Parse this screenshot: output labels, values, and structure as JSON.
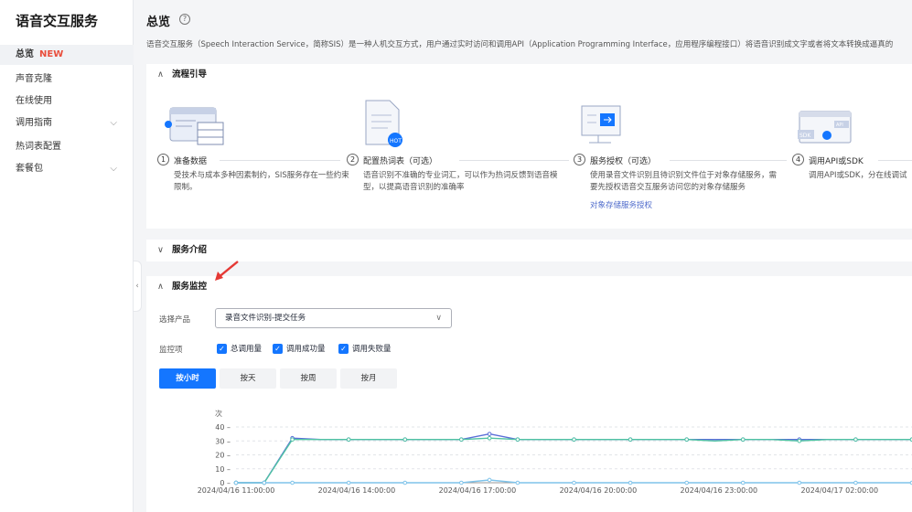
{
  "sidebar": {
    "title": "语音交互服务",
    "items": [
      {
        "label": "总览",
        "badge": "NEW"
      },
      {
        "label": "声音克隆"
      },
      {
        "label": "在线使用"
      },
      {
        "label": "调用指南",
        "chevron": "chevron-down-icon"
      },
      {
        "label": "热词表配置"
      },
      {
        "label": "套餐包",
        "chevron": "chevron-down-icon"
      }
    ]
  },
  "main": {
    "title": "总览",
    "description": "语音交互服务（Speech Interaction Service，简称SIS）是一种人机交互方式，用户通过实时访问和调用API（Application Programming Interface，应用程序编程接口）将语音识别成文字或者将文本转换成逼真的",
    "flow": {
      "header": "流程引导",
      "steps": [
        {
          "num": "1",
          "title": "准备数据",
          "desc": "受技术与成本多种因素制约，SIS服务存在一些约束限制。"
        },
        {
          "num": "2",
          "title": "配置热词表（可选）",
          "desc": "语音识别不准确的专业词汇，可以作为热词反馈到语音模型，以提高语音识别的准确率"
        },
        {
          "num": "3",
          "title": "服务授权（可选）",
          "desc": "使用录音文件识别且待识别文件位于对象存储服务，需要先授权语音交互服务访问您的对象存储服务",
          "link": "对象存储服务授权"
        },
        {
          "num": "4",
          "title": "调用API或SDK",
          "desc": "调用API或SDK，分在线调试"
        }
      ]
    },
    "intro": {
      "header": "服务介绍"
    },
    "monitor": {
      "header": "服务监控",
      "product_label": "选择产品",
      "product_value": "录音文件识别-提交任务",
      "items_label": "监控项",
      "checks": [
        "总调用量",
        "调用成功量",
        "调用失败量"
      ],
      "tabs": [
        "按小时",
        "按天",
        "按周",
        "按月"
      ],
      "active_tab": 0
    }
  },
  "chart_data": {
    "type": "line",
    "ylabel": "次",
    "ylim": [
      0,
      40
    ],
    "yticks": [
      0,
      10,
      20,
      30,
      40
    ],
    "x_tick_labels": [
      "2024/04/16 11:00:00",
      "2024/04/16 14:00:00",
      "2024/04/16 17:00:00",
      "2024/04/16 20:00:00",
      "2024/04/16 23:00:00",
      "2024/04/17 02:00:00"
    ],
    "series": [
      {
        "color": "#5b6fd8",
        "values": [
          0,
          0,
          32,
          31,
          31,
          31,
          31,
          31,
          31,
          35,
          31,
          31,
          31,
          31,
          31,
          31,
          31,
          31,
          31,
          31,
          31,
          31,
          31,
          31,
          31
        ]
      },
      {
        "color": "#4fc2a3",
        "values": [
          0,
          0,
          31,
          31,
          31,
          31,
          31,
          31,
          31,
          32,
          31,
          31,
          31,
          31,
          31,
          31,
          31,
          30,
          31,
          31,
          30,
          31,
          31,
          31,
          31
        ]
      },
      {
        "color": "#7ec3ea",
        "values": [
          0,
          0,
          0,
          0,
          0,
          0,
          0,
          0,
          0,
          2,
          0,
          0,
          0,
          0,
          0,
          0,
          0,
          0,
          0,
          0,
          0,
          0,
          0,
          0,
          0
        ]
      }
    ],
    "colors": {
      "accent": "#1476ff",
      "link": "#526ecc",
      "badge": "#e94e3c"
    }
  }
}
